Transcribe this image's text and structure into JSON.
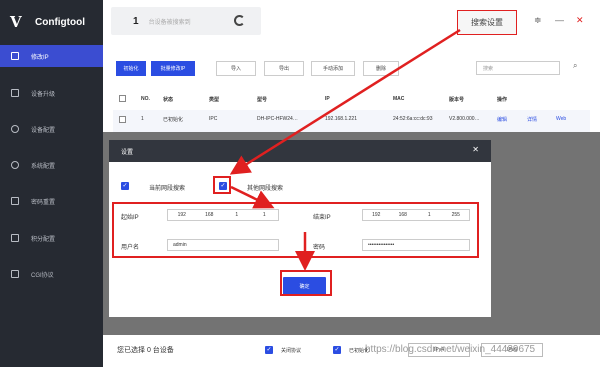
{
  "app": {
    "title": "Configtool"
  },
  "sidebar": {
    "items": [
      {
        "label": "修改IP",
        "icon": "edit-ip-icon"
      },
      {
        "label": "设备升级",
        "icon": "upgrade-icon"
      },
      {
        "label": "设备配置",
        "icon": "device-config-icon"
      },
      {
        "label": "系统配置",
        "icon": "system-config-icon"
      },
      {
        "label": "密码重置",
        "icon": "password-reset-icon"
      },
      {
        "label": "积分配置",
        "icon": "points-config-icon"
      },
      {
        "label": "CGI协议",
        "icon": "cgi-icon"
      }
    ]
  },
  "topbar": {
    "device_count": "1",
    "device_count_label": "台设备被搜索到",
    "search_settings": "搜索设置"
  },
  "toolbar": {
    "buttons": [
      "初始化",
      "批量修改IP",
      "导入",
      "导出",
      "手动添加",
      "删除"
    ],
    "search_placeholder": "搜索"
  },
  "table": {
    "headers": [
      "NO.",
      "状态",
      "类型",
      "型号",
      "IP",
      "MAC",
      "版本号",
      "操作"
    ],
    "rows": [
      {
        "no": "1",
        "status": "已初始化",
        "type": "IPC",
        "model": "DH-IPC-HFW24…",
        "ip": "192.168.1.221",
        "mac": "24:52:6a:cc:dc:93",
        "version": "V2.800.000…",
        "actions": [
          "编辑",
          "详情",
          "Web"
        ]
      }
    ]
  },
  "dialog": {
    "title": "设置",
    "current_segment_label": "当前网段搜索",
    "other_segment_label": "其他网段搜索",
    "start_ip_label": "起始IP",
    "start_ip": [
      "192",
      "168",
      "1",
      "1"
    ],
    "end_ip_label": "结束IP",
    "end_ip": [
      "192",
      "168",
      "1",
      "255"
    ],
    "username_label": "用户名",
    "username": "admin",
    "password_label": "密码",
    "password": "•••••••••••••••",
    "ok_button": "确定"
  },
  "footer": {
    "selected_text": "您已选择 0 台设备",
    "option1": "关闭协议",
    "option2": "已初始化",
    "tab_ipv4": "IPv4",
    "tab_ipv6": "IPv6",
    "watermark": "https://blog.csdn.net/weixin_44439675"
  },
  "colors": {
    "accent": "#2b4de2",
    "sidebar": "#262a32",
    "annotation": "#e02020"
  }
}
